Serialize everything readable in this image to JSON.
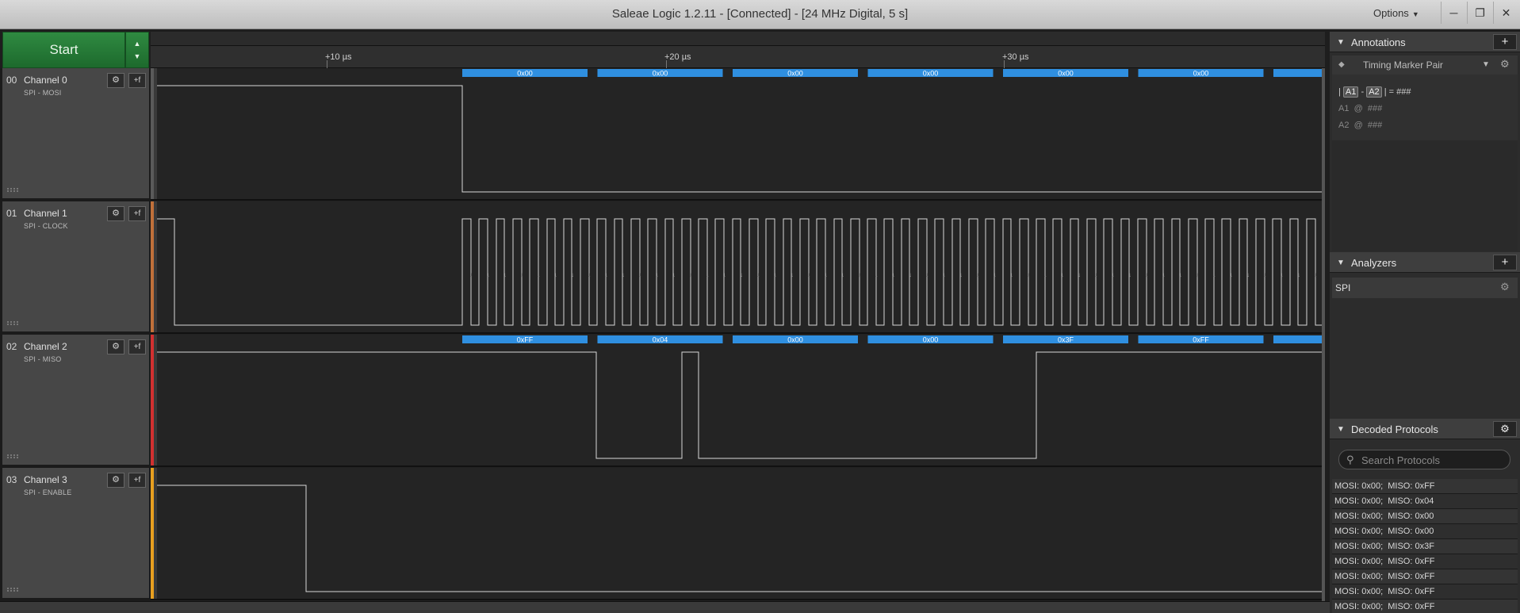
{
  "window": {
    "title": "Saleae Logic 1.2.11 - [Connected] - [24 MHz Digital, 5 s]",
    "options_label": "Options",
    "minimize": "─",
    "restore": "❐",
    "close": "✕"
  },
  "start_button": {
    "label": "Start",
    "up": "▲",
    "down": "▼"
  },
  "ruler": {
    "ticks": [
      "+10 µs",
      "+20 µs",
      "+30 µs"
    ]
  },
  "channels": [
    {
      "num": "00",
      "name": "Channel 0",
      "sub": "SPI - MOSI",
      "color": "#5a5a5a"
    },
    {
      "num": "01",
      "name": "Channel 1",
      "sub": "SPI - CLOCK",
      "color": "#c0703a"
    },
    {
      "num": "02",
      "name": "Channel 2",
      "sub": "SPI - MISO",
      "color": "#d23030"
    },
    {
      "num": "03",
      "name": "Channel 3",
      "sub": "SPI - ENABLE",
      "color": "#e8a020"
    }
  ],
  "channel_buttons": {
    "gear": "⚙",
    "trigger": "+f"
  },
  "decode": {
    "mosi": [
      "0x00",
      "0x00",
      "0x00",
      "0x00",
      "0x00",
      "0x00"
    ],
    "miso": [
      "0xFF",
      "0x04",
      "0x00",
      "0x00",
      "0x3F",
      "0xFF"
    ]
  },
  "signal_transitions": {
    "mosi": {
      "initial": 1,
      "edges": [
        385
      ]
    },
    "clock": {
      "initial": 1,
      "first_edge": 22,
      "burst_start": 385,
      "cycles": 53
    },
    "miso": {
      "initial": 1,
      "edges": [
        554,
        662,
        683,
        1109
      ]
    },
    "enable": {
      "initial": 1,
      "edges": [
        188
      ]
    }
  },
  "annotations": {
    "title": "Annotations",
    "add": "+",
    "marker_title": "Timing Marker Pair",
    "marker_icon": "◆",
    "dropdown": "▼",
    "gear": "⚙",
    "line1": [
      "A1",
      "-",
      "A2",
      "=",
      "###"
    ],
    "line2": [
      "A1",
      "@",
      "###"
    ],
    "line3": [
      "A2",
      "@",
      "###"
    ]
  },
  "analyzers": {
    "title": "Analyzers",
    "add": "+",
    "items": [
      "SPI"
    ],
    "gear": "⚙"
  },
  "decoded_protocols": {
    "title": "Decoded Protocols",
    "gear": "⚙",
    "search_placeholder": "Search Protocols",
    "items": [
      "MOSI: 0x00;  MISO: 0xFF",
      "MOSI: 0x00;  MISO: 0x04",
      "MOSI: 0x00;  MISO: 0x00",
      "MOSI: 0x00;  MISO: 0x00",
      "MOSI: 0x00;  MISO: 0x3F",
      "MOSI: 0x00;  MISO: 0xFF",
      "MOSI: 0x00;  MISO: 0xFF",
      "MOSI: 0x00;  MISO: 0xFF",
      "MOSI: 0x00;  MISO: 0xFF"
    ]
  },
  "triangle": "▼"
}
